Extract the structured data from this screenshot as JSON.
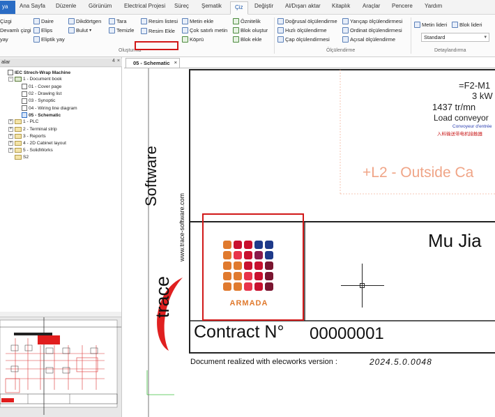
{
  "ribbon_tabs": [
    {
      "id": "file",
      "label": "ya"
    },
    {
      "id": "home",
      "label": "Ana Sayfa"
    },
    {
      "id": "edit",
      "label": "Düzenle"
    },
    {
      "id": "view",
      "label": "Görünüm"
    },
    {
      "id": "electrical",
      "label": "Electrical Projesi"
    },
    {
      "id": "process",
      "label": "Süreç"
    },
    {
      "id": "schematic",
      "label": "Şematik"
    },
    {
      "id": "draw",
      "label": "Çiz"
    },
    {
      "id": "modify",
      "label": "Değiştir"
    },
    {
      "id": "import",
      "label": "Al/Dışarı aktar"
    },
    {
      "id": "library",
      "label": "Kitaplık"
    },
    {
      "id": "tools",
      "label": "Araçlar"
    },
    {
      "id": "window",
      "label": "Pencere"
    },
    {
      "id": "help",
      "label": "Yardım"
    }
  ],
  "ribbon": {
    "draw_tools": [
      "Çizgi",
      "Daire",
      "Dikdörtgen",
      "Devamlı çizgi",
      "Elips",
      "Bulut",
      "yay",
      "Eliptik yay"
    ],
    "hatch": "Tara",
    "clean": "Temizle",
    "image_list": "Resim listesi",
    "insert_image": "Resim Ekle",
    "text_add": "Metin ekle",
    "multiline_text": "Çok satırlı metin",
    "bridge": "Köprü",
    "attribute": "Öznitelik",
    "block_create": "Blok oluştur",
    "block_insert": "Blok ekle",
    "group_create": "Oluşturma",
    "dim_linear": "Doğrusal ölçülendirme",
    "dim_quick": "Hızlı ölçülendirme",
    "dim_diameter": "Çap ölçülendirmesi",
    "dim_radius": "Yarıçap ölçülendirmesi",
    "dim_ordinate": "Ordinat ölçülendirmesi",
    "dim_angular": "Açısal ölçülendirme",
    "group_dimension": "Ölçülendirme",
    "leader_text": "Metin lideri",
    "leader_block": "Blok lideri",
    "style_value": "Standard",
    "group_detail": "Detaylandırma"
  },
  "panel": {
    "title": "alar",
    "pin": "4",
    "close": "×"
  },
  "tree": [
    {
      "level": 0,
      "label": "IEC Strech-Wrap Machine",
      "type": "project",
      "bold": true,
      "pm": ""
    },
    {
      "level": 1,
      "label": "1 - Document book",
      "type": "book",
      "bold": false,
      "pm": "−"
    },
    {
      "level": 2,
      "label": "01 - Cover page",
      "type": "page",
      "bold": false,
      "pm": ""
    },
    {
      "level": 2,
      "label": "02 - Drawing list",
      "type": "page",
      "bold": false,
      "pm": ""
    },
    {
      "level": 2,
      "label": "03 - Synoptic",
      "type": "page",
      "bold": false,
      "pm": ""
    },
    {
      "level": 2,
      "label": "04 - Wiring line diagram",
      "type": "page",
      "bold": false,
      "pm": ""
    },
    {
      "level": 2,
      "label": "05 - Schematic",
      "type": "page-selected",
      "bold": true,
      "pm": ""
    },
    {
      "level": 1,
      "label": "1 - PLC",
      "type": "folder",
      "bold": false,
      "pm": "+"
    },
    {
      "level": 1,
      "label": "2 - Terminal strip",
      "type": "folder",
      "bold": false,
      "pm": "+"
    },
    {
      "level": 1,
      "label": "3 - Reports",
      "type": "folder",
      "bold": false,
      "pm": "+"
    },
    {
      "level": 1,
      "label": "4 - 2D Cabinet layout",
      "type": "folder",
      "bold": false,
      "pm": "+"
    },
    {
      "level": 1,
      "label": "5 - SolidWorks",
      "type": "folder",
      "bold": false,
      "pm": "+"
    },
    {
      "level": 1,
      "label": "S2",
      "type": "folder",
      "bold": false,
      "pm": ""
    }
  ],
  "document_tab": {
    "label": "05 - Schematic",
    "close": "×"
  },
  "drawing": {
    "ref": "=F2-M1",
    "power": "3 kW",
    "speed": "1437 tr/mn",
    "load": "Load conveyor",
    "conveyor_fr": "Convoyeur d'entrée",
    "conveyor_cn": "入料输送带电机接触器",
    "location": "+L2 - Outside Ca",
    "name": "Mu Jia",
    "company_url": "www.trace-software.com",
    "company_word1": "Software",
    "company_word2": "trace",
    "logo_text": "ARMADA",
    "contract_label": "Contract N°",
    "contract_number": "00000001",
    "version_label": "Document realized with elecworks version :",
    "version_value": "2024.5.0.0048"
  },
  "colors": {
    "accent": "#2a6cc4",
    "highlight": "#d11818",
    "location_text": "#f0a587",
    "logo_orange": "#e07a2e",
    "logo_red": "#c8102e",
    "logo_maroon": "#7a1530",
    "logo_navy": "#1e3a8a"
  }
}
